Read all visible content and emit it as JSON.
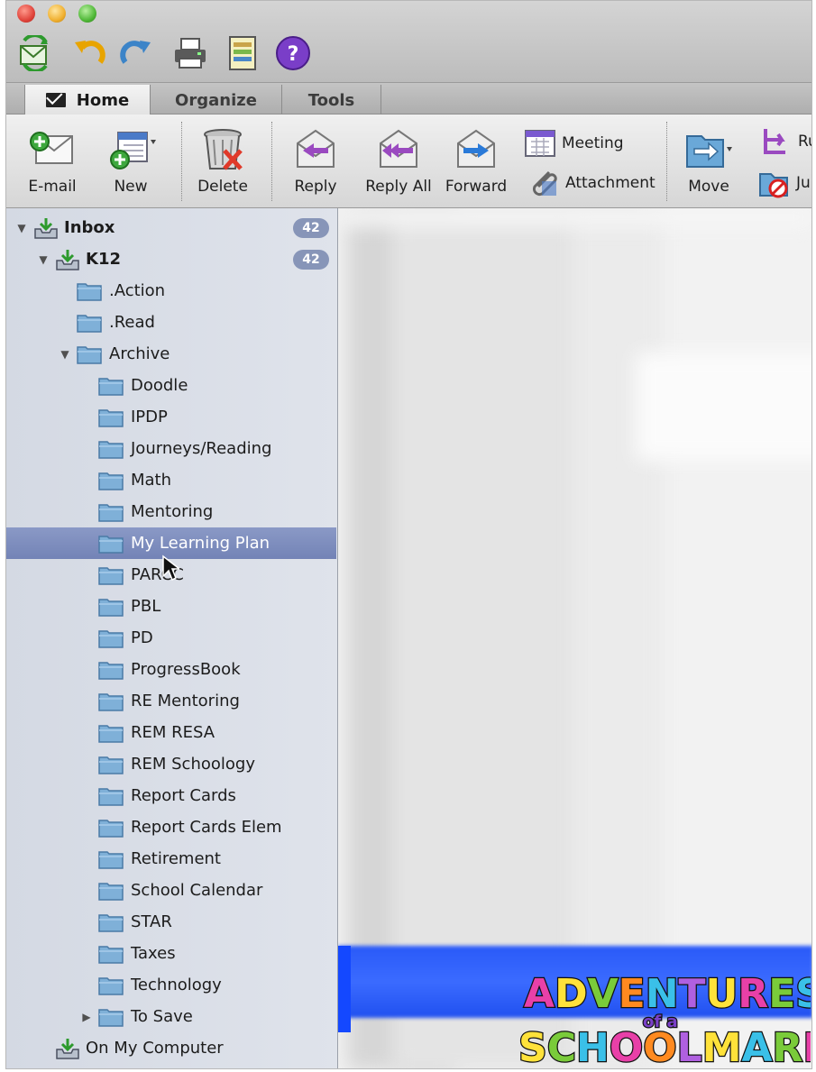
{
  "window": {
    "traffic_lights": [
      "close",
      "minimize",
      "zoom"
    ],
    "colors": {
      "accent": "#7383b6",
      "badge": "#8795b8",
      "selection": "#7f8ec0"
    }
  },
  "quick_access": [
    {
      "name": "send-receive-icon"
    },
    {
      "name": "undo-icon"
    },
    {
      "name": "redo-icon"
    },
    {
      "name": "print-icon"
    },
    {
      "name": "layout-icon"
    },
    {
      "name": "help-icon",
      "label": "?"
    }
  ],
  "tabs": [
    {
      "label": "Home",
      "active": true
    },
    {
      "label": "Organize",
      "active": false
    },
    {
      "label": "Tools",
      "active": false
    }
  ],
  "ribbon": {
    "email": "E-mail",
    "new": "New",
    "delete": "Delete",
    "reply": "Reply",
    "reply_all": "Reply All",
    "forward": "Forward",
    "meeting": "Meeting",
    "attachment": "Attachment",
    "move": "Move",
    "rules_partial": "Ru",
    "junk_partial": "Ju"
  },
  "sidebar": {
    "inbox": {
      "label": "Inbox",
      "count": "42"
    },
    "account": {
      "label": "K12",
      "count": "42"
    },
    "folders_level1": [
      ".Action",
      ".Read",
      "Archive"
    ],
    "archive_children": [
      "Doodle",
      "IPDP",
      "Journeys/Reading",
      "Math",
      "Mentoring",
      "My Learning Plan",
      "PARCC",
      "PBL",
      "PD",
      "ProgressBook",
      "RE Mentoring",
      "REM RESA",
      "REM Schoology",
      "Report Cards",
      "Report Cards Elem",
      "Retirement",
      "School Calendar",
      "STAR",
      "Taxes",
      "Technology"
    ],
    "to_save": "To Save",
    "on_my_computer": "On My Computer",
    "selected": "My Learning Plan"
  },
  "watermark": {
    "line1": "ADVENTURES",
    "line2": "of a",
    "line3": "SCHOOLMARM"
  }
}
